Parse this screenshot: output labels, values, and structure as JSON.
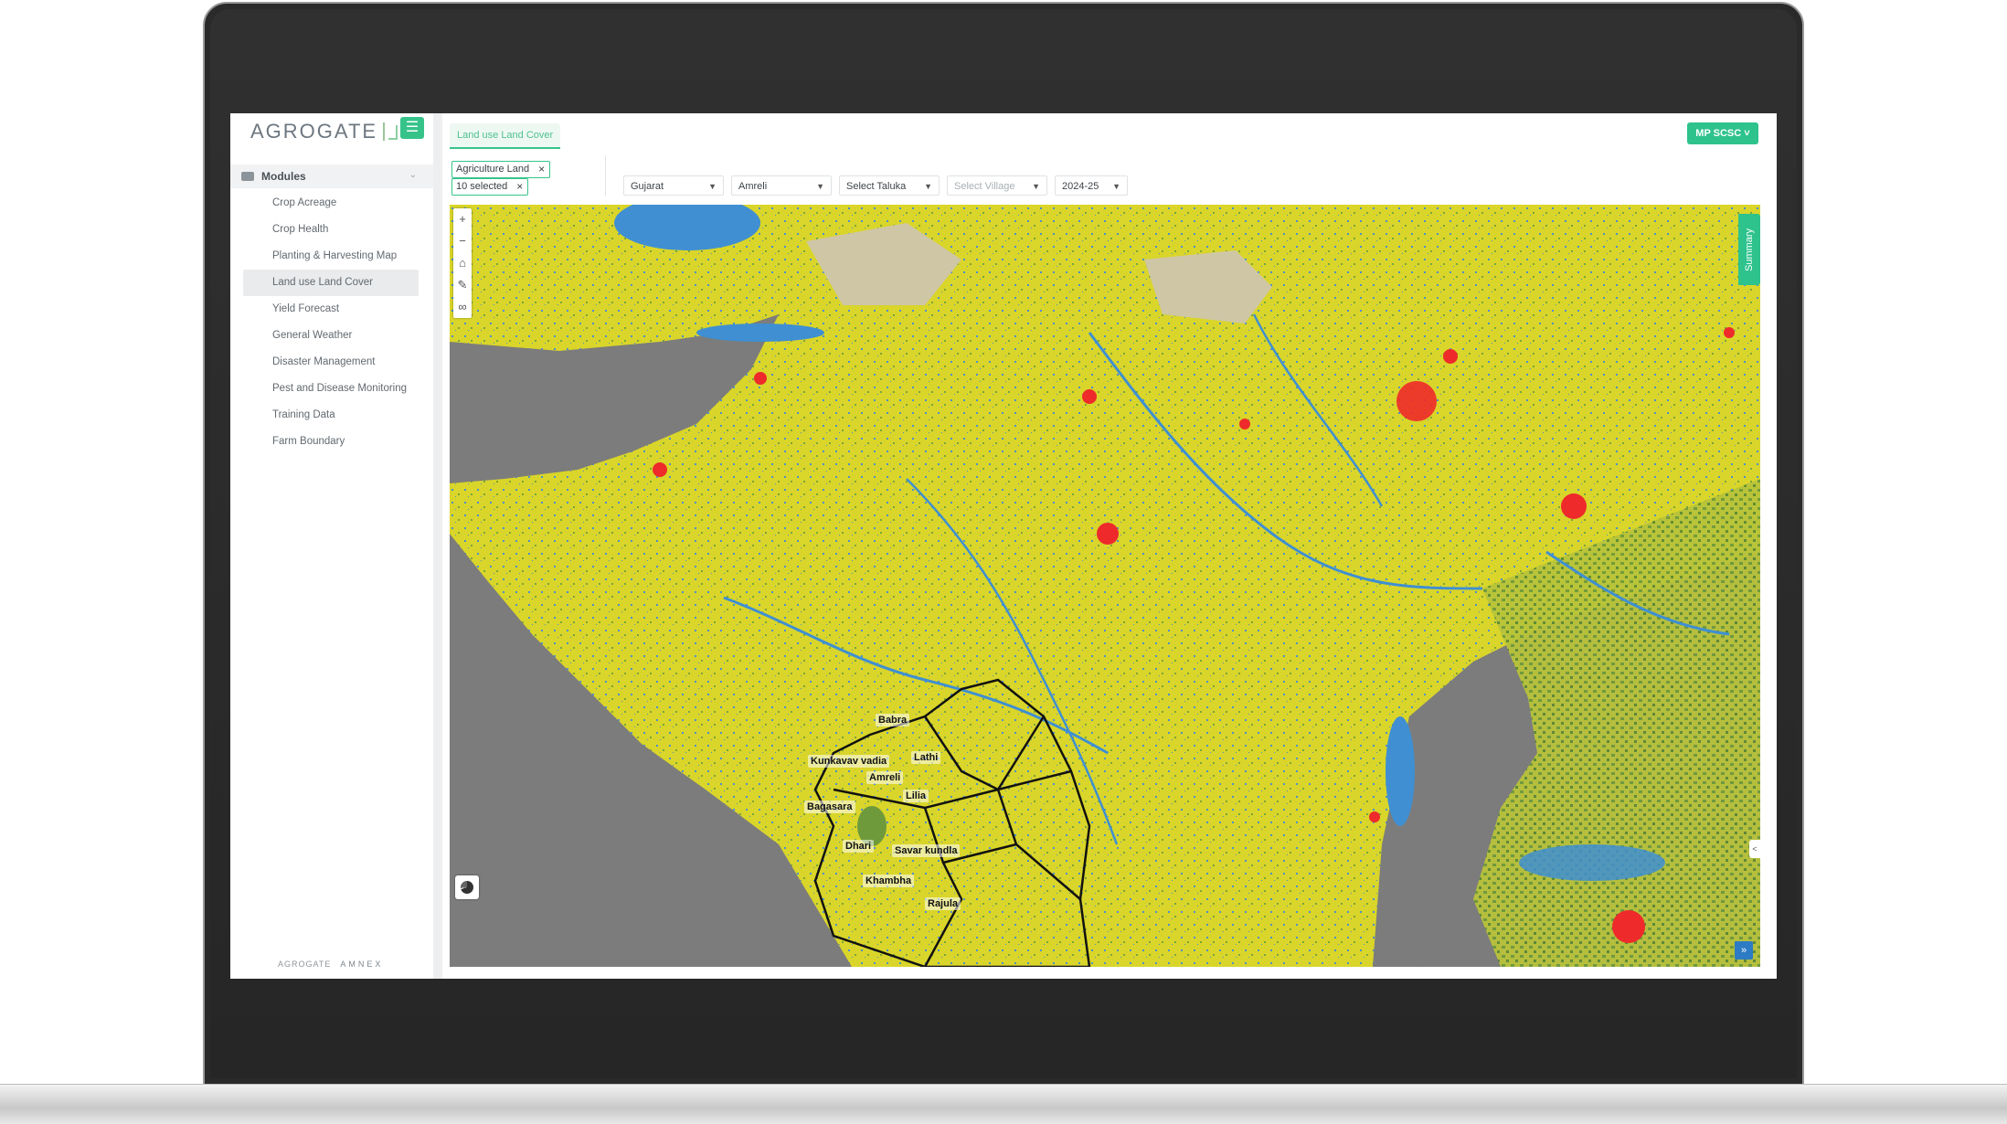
{
  "brand": {
    "logo": "AGROGATE",
    "footer_logo": "AGROGATE",
    "footer_partner": "AMNEX"
  },
  "sidebar": {
    "modules_label": "Modules",
    "items": [
      {
        "label": "Crop Acreage"
      },
      {
        "label": "Crop Health"
      },
      {
        "label": "Planting & Harvesting Map"
      },
      {
        "label": "Land use Land Cover",
        "active": true
      },
      {
        "label": "Yield Forecast"
      },
      {
        "label": "General Weather"
      },
      {
        "label": "Disaster Management"
      },
      {
        "label": "Pest and Disease Monitoring"
      },
      {
        "label": "Training Data"
      },
      {
        "label": "Farm Boundary"
      }
    ]
  },
  "header": {
    "tab_label": "Land use Land Cover",
    "org_button": "MP SCSC"
  },
  "filters": {
    "chip_1": "Agriculture Land",
    "chip_2": "10 selected",
    "state": "Gujarat",
    "district": "Amreli",
    "taluka_placeholder": "Select Taluka",
    "village_placeholder": "Select Village",
    "season": "2024-25"
  },
  "map": {
    "summary_label": "Summary",
    "controls": [
      "zoom-in",
      "zoom-out",
      "home",
      "draw",
      "measure"
    ],
    "talukas": [
      "Babra",
      "Kunkavav vadia",
      "Lathi",
      "Amreli",
      "Lilia",
      "Bagasara",
      "Dhari",
      "Savar kundla",
      "Khambha",
      "Rajula"
    ],
    "colors": {
      "agriculture": "#d9d52a",
      "water": "#3f8fd2",
      "builtup": "#ee2a2a",
      "vegetation": "#6f9a3c",
      "barren": "#cfc6a6",
      "sea": "#7c7c7c",
      "accent": "#2ec28d"
    }
  }
}
